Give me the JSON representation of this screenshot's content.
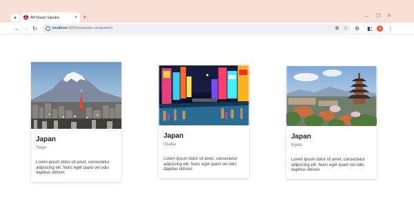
{
  "browser": {
    "tab": {
      "title": "Alif Razan Saputra"
    },
    "address": {
      "host": "localhost",
      "path": ":4200/example-component"
    },
    "profile_initial": "A"
  },
  "cards": [
    {
      "title": "Japan",
      "subtitle": "Tokyo",
      "description": "Lorem ipsum dolor sit amet, consectetur adipiscing elit. Nunc eget quam vel odio dapibus ultrices",
      "image": "mount-fuji-tokyo-photo"
    },
    {
      "title": "Japan",
      "subtitle": "Osaka",
      "description": "Lorem ipsum dolor sit amet, consectetur adipiscing elit. Nunc eget quam vel odio dapibus ultrices",
      "image": "osaka-dotonbori-night-photo"
    },
    {
      "title": "Japan",
      "subtitle": "Kyoto",
      "description": "Lorem ipsum dolor sit amet, consectetur adipiscing elit. Nunc eget quam vel odio dapibus ultrices",
      "image": "kyoto-pagoda-photo"
    }
  ]
}
